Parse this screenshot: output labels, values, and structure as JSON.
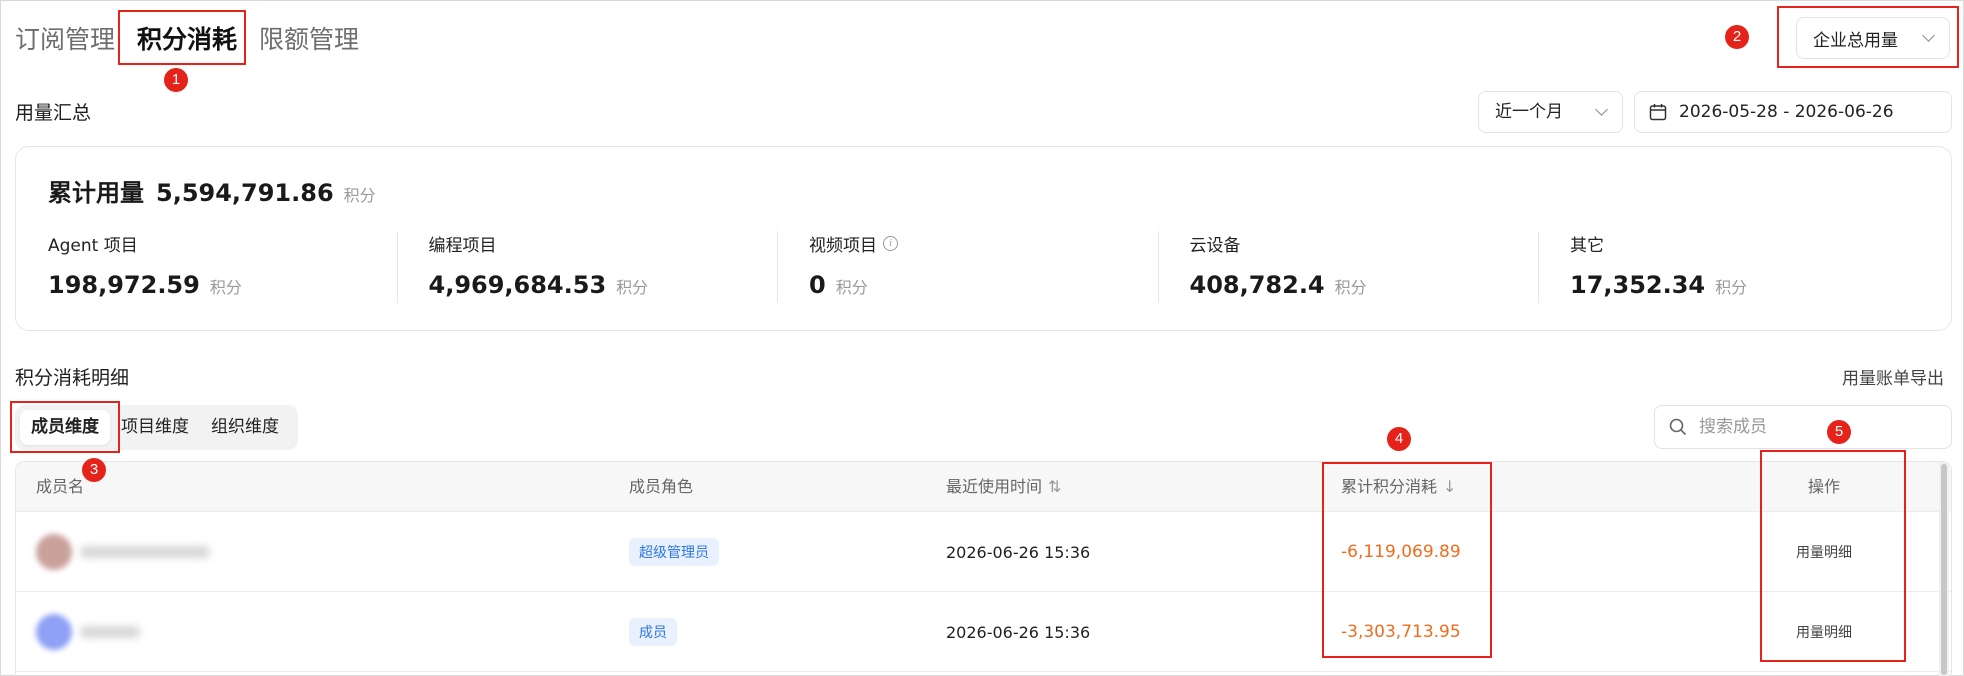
{
  "tabs": [
    {
      "label": "订阅管理"
    },
    {
      "label": "积分消耗"
    },
    {
      "label": "限额管理"
    }
  ],
  "scope_select": {
    "value": "企业总用量"
  },
  "summary": {
    "title": "用量汇总",
    "range": "近一个月",
    "date_range": "2026-05-28 - 2026-06-26",
    "total_label": "累计用量",
    "total_value": "5,594,791.86",
    "unit": "积分",
    "metrics": [
      {
        "label": "Agent 项目",
        "value": "198,972.59",
        "unit": "积分"
      },
      {
        "label": "编程项目",
        "value": "4,969,684.53",
        "unit": "积分"
      },
      {
        "label": "视频项目",
        "value": "0",
        "unit": "积分"
      },
      {
        "label": "云设备",
        "value": "408,782.4",
        "unit": "积分"
      },
      {
        "label": "其它",
        "value": "17,352.34",
        "unit": "积分"
      }
    ]
  },
  "detail": {
    "title": "积分消耗明细",
    "export": "用量账单导出",
    "dimensions": [
      {
        "label": "成员维度"
      },
      {
        "label": "项目维度"
      },
      {
        "label": "组织维度"
      }
    ],
    "search_placeholder": "搜索成员",
    "columns": {
      "name": "成员名",
      "role": "成员角色",
      "last_used": "最近使用时间",
      "consumption": "累计积分消耗",
      "action": "操作"
    },
    "rows": [
      {
        "role": "超级管理员",
        "last_used": "2026-06-26 15:36",
        "consumption": "-6,119,069.89",
        "action": "用量明细"
      },
      {
        "role": "成员",
        "last_used": "2026-06-26 15:36",
        "consumption": "-3,303,713.95",
        "action": "用量明细"
      }
    ]
  },
  "annotations": [
    "1",
    "2",
    "3",
    "4",
    "5"
  ],
  "colors": {
    "annotation": "#e5231b",
    "negative_value": "#f26b1d",
    "role_tag_text": "#2f77e0",
    "role_tag_bg": "#e8f1fd"
  }
}
